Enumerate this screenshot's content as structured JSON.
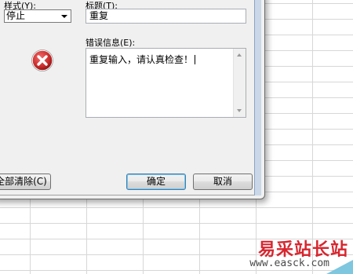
{
  "dialog": {
    "style_label": "样式(Y):",
    "style_value": "停止",
    "title_label": "标题(T):",
    "title_value": "重复",
    "error_label": "错误信息(E):",
    "error_value": "重复输入，请认真检查！",
    "clear_all_label": "全部清除(C)",
    "ok_label": "确定",
    "cancel_label": "取消"
  },
  "watermark": {
    "brand": "易采站长站",
    "url": "www.easck.com"
  },
  "colors": {
    "error_red": "#c92a2a",
    "watermark_red": "#d7262f"
  }
}
